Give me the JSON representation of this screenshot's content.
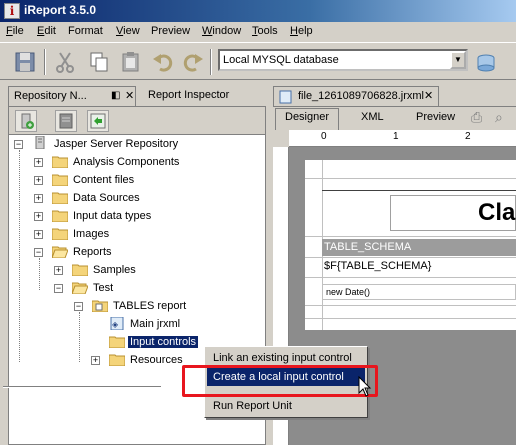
{
  "window": {
    "title": "iReport 3.5.0",
    "icon": "ireport-logo-icon"
  },
  "menubar": [
    {
      "label": "File",
      "acc": "F",
      "rest": "ile"
    },
    {
      "label": "Edit",
      "acc": "E",
      "rest": "dit"
    },
    {
      "label": "Format",
      "acc": "",
      "rest": "Format"
    },
    {
      "label": "View",
      "acc": "V",
      "rest": "iew"
    },
    {
      "label": "Preview",
      "acc": "",
      "rest": "Preview"
    },
    {
      "label": "Window",
      "acc": "W",
      "rest": "indow"
    },
    {
      "label": "Tools",
      "acc": "T",
      "rest": "ools"
    },
    {
      "label": "Help",
      "acc": "H",
      "rest": "elp"
    }
  ],
  "toolbar": {
    "icons": [
      "save-icon",
      "cut-icon",
      "copy-icon",
      "paste-icon",
      "undo-icon",
      "redo-icon"
    ],
    "datasource": "Local MYSQL database",
    "datasource_icon": "database-connection-icon"
  },
  "left_panel": {
    "tabs": [
      {
        "label": "Repository N...",
        "active": true
      },
      {
        "label": "Report Inspector",
        "active": false
      }
    ],
    "toolbar_icons": [
      "add-server-icon",
      "properties-icon",
      "refresh-icon"
    ],
    "tree": {
      "root": "Jasper Server Repository",
      "items": [
        {
          "label": "Analysis Components",
          "level": 1,
          "expander": "+"
        },
        {
          "label": "Content files",
          "level": 1,
          "expander": "+"
        },
        {
          "label": "Data Sources",
          "level": 1,
          "expander": "+"
        },
        {
          "label": "Input data types",
          "level": 1,
          "expander": "+"
        },
        {
          "label": "Images",
          "level": 1,
          "expander": "+"
        },
        {
          "label": "Reports",
          "level": 1,
          "expander": "-"
        },
        {
          "label": "Samples",
          "level": 2,
          "expander": "+"
        },
        {
          "label": "Test",
          "level": 2,
          "expander": "-"
        },
        {
          "label": "TABLES report",
          "level": 3,
          "expander": "-"
        },
        {
          "label": "Main jrxml",
          "level": 4,
          "expander": ""
        },
        {
          "label": "Input controls",
          "level": 4,
          "expander": "",
          "selected": true
        },
        {
          "label": "Resources",
          "level": 4,
          "expander": "+"
        }
      ]
    }
  },
  "editor": {
    "file_tab": "file_1261089706828.jrxml",
    "view_tabs": [
      "Designer",
      "XML",
      "Preview"
    ],
    "active_view": "Designer",
    "ruler_numbers": [
      "0",
      "1",
      "2"
    ],
    "report_title": "Cla",
    "column_header": "TABLE_SCHEMA",
    "field": "$F{TABLE_SCHEMA}",
    "page_footer": "new Date()"
  },
  "context_menu": {
    "items": [
      {
        "label": "Link an existing input control",
        "highlighted": false
      },
      {
        "label": "Create a local input control",
        "highlighted": true
      },
      {
        "label": "Run Report Unit",
        "highlighted": false
      }
    ],
    "accent_color": "#e8161e",
    "selection_color": "#0a246a"
  }
}
